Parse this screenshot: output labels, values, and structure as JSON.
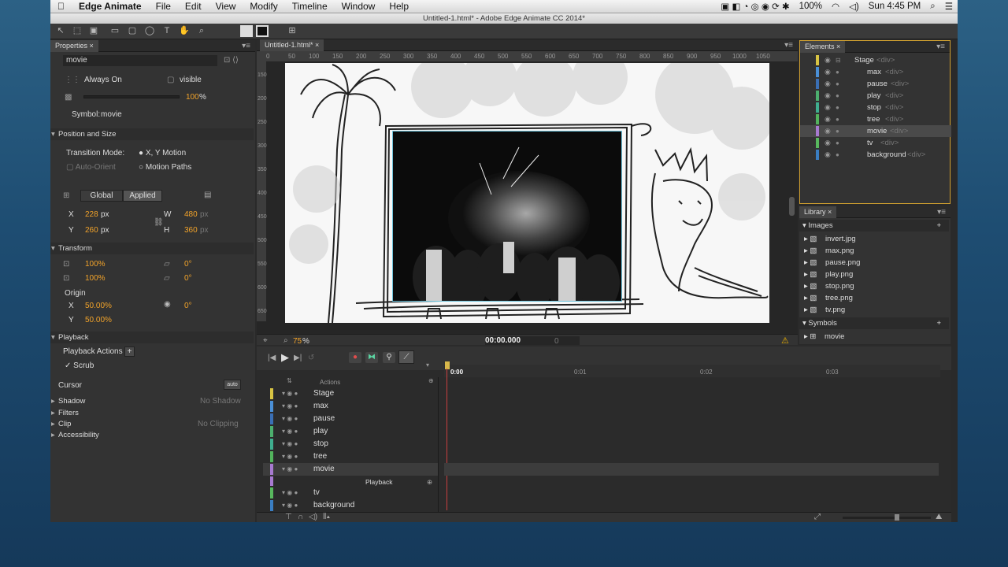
{
  "menubar": {
    "apple": "",
    "app": "Edge Animate",
    "items": [
      "File",
      "Edit",
      "View",
      "Modify",
      "Timeline",
      "Window",
      "Help"
    ],
    "battery": "100%",
    "clock": "Sun 4:45 PM"
  },
  "window": {
    "title": "Untitled-1.html* - Adobe Edge Animate CC 2014*"
  },
  "properties": {
    "tab": "Properties",
    "element_name": "movie",
    "overflow": "Always On",
    "visibility": "visible",
    "opacity_value": "100",
    "opacity_unit": "%",
    "symbol_label": "Symbol:",
    "symbol_name": "movie",
    "position_size": "Position and Size",
    "transition_mode_label": "Transition Mode:",
    "transition_xy": "X, Y Motion",
    "auto_orient": "Auto-Orient",
    "motion_paths": "Motion Paths",
    "global": "Global",
    "applied": "Applied",
    "x_label": "X",
    "x_value": "228",
    "x_unit": "px",
    "y_label": "Y",
    "y_value": "260",
    "y_unit": "px",
    "w_label": "W",
    "w_value": "480",
    "w_unit": "px",
    "h_label": "H",
    "h_value": "360",
    "h_unit": "px",
    "transform": "Transform",
    "scale_x": "100%",
    "scale_y": "100%",
    "skew_x": "0°",
    "skew_y": "0°",
    "origin": "Origin",
    "origin_x_label": "X",
    "origin_x": "50.00%",
    "origin_y_label": "Y",
    "origin_y": "50.00%",
    "rotate": "0°",
    "playback": "Playback",
    "playback_actions": "Playback Actions",
    "scrub": "Scrub",
    "cursor": "Cursor",
    "cursor_value": "auto",
    "shadow": "Shadow",
    "shadow_value": "No Shadow",
    "filters": "Filters",
    "clip": "Clip",
    "clip_value": "No Clipping",
    "accessibility": "Accessibility"
  },
  "stage": {
    "tab": "Untitled-1.html*",
    "ruler_h": [
      "0",
      "50",
      "100",
      "150",
      "200",
      "250",
      "300",
      "350",
      "400",
      "450",
      "500",
      "550",
      "600",
      "650",
      "700",
      "750",
      "800",
      "850",
      "900",
      "950",
      "1000",
      "1050"
    ],
    "ruler_v": [
      "150",
      "200",
      "250",
      "300",
      "350",
      "400",
      "450",
      "500",
      "550",
      "600",
      "650"
    ],
    "zoom": "75",
    "zoom_unit": "%"
  },
  "timeline": {
    "time": "00:00.000",
    "small_time": "0",
    "actions": "Actions",
    "ticks": [
      "0:00",
      "0:01",
      "0:02",
      "0:03"
    ],
    "playback_label": "Playback",
    "layers": [
      {
        "name": "Stage",
        "color": "#d8c443"
      },
      {
        "name": "max",
        "color": "#4a8fd6"
      },
      {
        "name": "pause",
        "color": "#3a6fb5"
      },
      {
        "name": "play",
        "color": "#4caf6e"
      },
      {
        "name": "stop",
        "color": "#3fae8f"
      },
      {
        "name": "tree",
        "color": "#52b35c"
      },
      {
        "name": "movie",
        "color": "#a77ad0"
      },
      {
        "name": "tv",
        "color": "#58b85e"
      },
      {
        "name": "background",
        "color": "#3a7ec2"
      }
    ]
  },
  "elements": {
    "tab": "Elements",
    "items": [
      {
        "name": "Stage",
        "tag": "<div>",
        "color": "#d8c443"
      },
      {
        "name": "max",
        "tag": "<div>",
        "color": "#4a8fd6"
      },
      {
        "name": "pause",
        "tag": "<div>",
        "color": "#3a6fb5"
      },
      {
        "name": "play",
        "tag": "<div>",
        "color": "#4caf6e"
      },
      {
        "name": "stop",
        "tag": "<div>",
        "color": "#3fae8f"
      },
      {
        "name": "tree",
        "tag": "<div>",
        "color": "#52b35c"
      },
      {
        "name": "movie",
        "tag": "<div>",
        "color": "#a77ad0"
      },
      {
        "name": "tv",
        "tag": "<div>",
        "color": "#58b85e"
      },
      {
        "name": "background",
        "tag": "<div>",
        "color": "#3a7ec2"
      }
    ]
  },
  "library": {
    "tab": "Library",
    "images_label": "Images",
    "images": [
      "invert.jpg",
      "max.png",
      "pause.png",
      "play.png",
      "stop.png",
      "tree.png",
      "tv.png"
    ],
    "symbols_label": "Symbols",
    "symbols": [
      "movie"
    ]
  }
}
